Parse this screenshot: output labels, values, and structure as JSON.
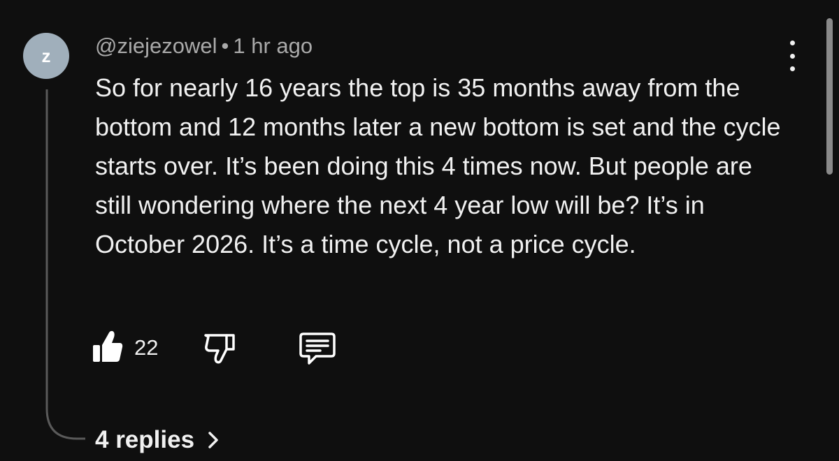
{
  "comment": {
    "avatar_letter": "z",
    "username": "@ziejezowel",
    "separator": "•",
    "timestamp": "1 hr ago",
    "text": "So for nearly 16 years the top is 35 months away from the bottom and 12 months later a new bottom is set and the cycle starts over. It’s been doing this 4 times now. But people are still wondering where the next 4 year low will be? It’s in October 2026. It’s a time cycle, not a price cycle.",
    "like_count": "22",
    "replies_label": "4 replies"
  },
  "icons": {
    "like": "thumbs-up-icon",
    "dislike": "thumbs-down-icon",
    "reply": "comment-icon",
    "menu": "more-vertical-icon",
    "replies": "chevron-right-icon"
  },
  "colors": {
    "background": "#0f0f0f",
    "text": "#f1f1f1",
    "meta": "#aaaaaa",
    "avatar": "#a0afbb"
  }
}
